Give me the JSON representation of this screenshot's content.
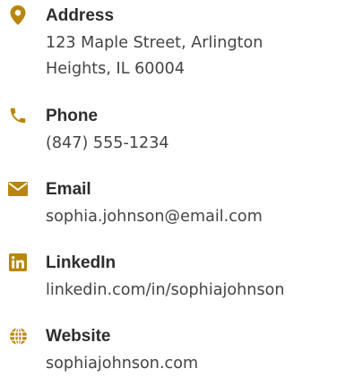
{
  "colors": {
    "accent": "#b8860b",
    "label": "#2d2d2d",
    "value": "#444444"
  },
  "contacts": [
    {
      "icon": "map-pin-icon",
      "label": "Address",
      "lines": [
        "123 Maple Street, Arlington",
        "Heights, IL 60004"
      ]
    },
    {
      "icon": "phone-icon",
      "label": "Phone",
      "lines": [
        "(847) 555-1234"
      ]
    },
    {
      "icon": "envelope-icon",
      "label": "Email",
      "lines": [
        "sophia.johnson@email.com"
      ]
    },
    {
      "icon": "linkedin-icon",
      "label": "LinkedIn",
      "lines": [
        "linkedin.com/in/sophiajohnson"
      ]
    },
    {
      "icon": "globe-icon",
      "label": "Website",
      "lines": [
        "sophiajohnson.com"
      ]
    }
  ]
}
